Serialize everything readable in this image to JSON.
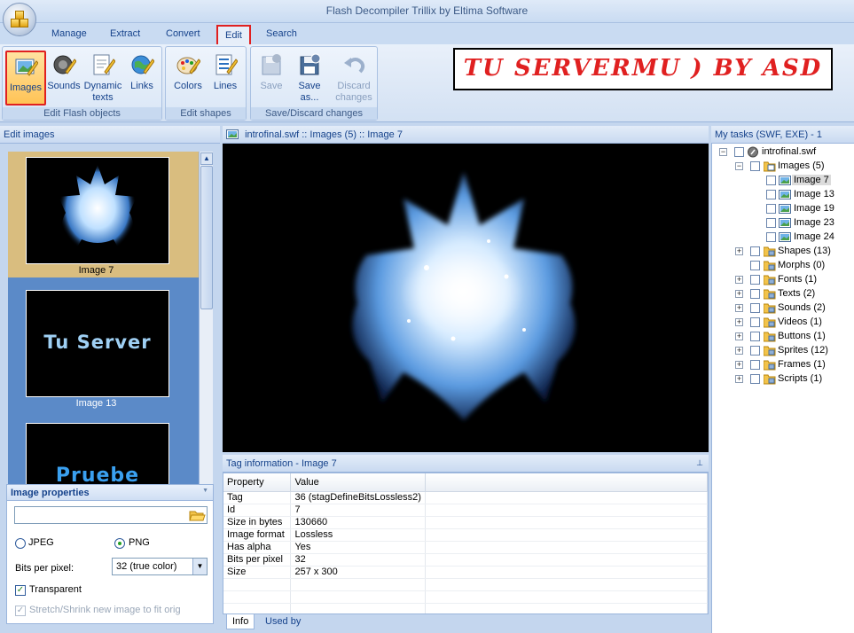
{
  "window": {
    "title": "Flash Decompiler Trillix by Eltima Software"
  },
  "menu": {
    "tabs": [
      "Manage",
      "Extract",
      "Convert",
      "Edit",
      "Search"
    ],
    "active": "Edit"
  },
  "ribbon": {
    "groups": {
      "edit_flash_objects": "Edit Flash objects",
      "edit_shapes": "Edit shapes",
      "save_discard": "Save/Discard changes"
    },
    "buttons": {
      "images": "Images",
      "sounds": "Sounds",
      "dynamic_texts_1": "Dynamic",
      "dynamic_texts_2": "texts",
      "links": "Links",
      "colors": "Colors",
      "lines": "Lines",
      "save": "Save",
      "save_as_1": "Save",
      "save_as_2": "as...",
      "discard_1": "Discard",
      "discard_2": "changes"
    }
  },
  "banner": {
    "text": "TU SERVERMU ) BY ASD"
  },
  "left_panel": {
    "title": "Edit images",
    "thumbnails": [
      {
        "caption": "Image 7",
        "selected": true
      },
      {
        "caption": "Image 13",
        "art_text": "Tu Server",
        "selected": false
      },
      {
        "caption": "",
        "art_text": "Pruebe",
        "selected": false
      }
    ],
    "properties": {
      "title": "Image properties",
      "file_value": "",
      "format_jpeg": "JPEG",
      "format_png": "PNG",
      "format_selected": "PNG",
      "bits_label": "Bits per pixel:",
      "bits_value": "32 (true color)",
      "transparent_label": "Transparent",
      "transparent_checked": true,
      "stretch_label": "Stretch/Shrink new image to fit orig",
      "stretch_checked": true
    }
  },
  "preview": {
    "title": "introfinal.swf :: Images (5) :: Image 7"
  },
  "tag_info": {
    "title": "Tag information - Image 7",
    "columns": [
      "Property",
      "Value"
    ],
    "rows": [
      [
        "Tag",
        "36 (stagDefineBitsLossless2)"
      ],
      [
        "Id",
        "7"
      ],
      [
        "Size in bytes",
        "130660"
      ],
      [
        "Image format",
        "Lossless"
      ],
      [
        "Has alpha",
        "Yes"
      ],
      [
        "Bits per pixel",
        "32"
      ],
      [
        "Size",
        "257 x 300"
      ]
    ],
    "tabs": [
      "Info",
      "Used by"
    ],
    "pin_icon": "pin-icon"
  },
  "tasks": {
    "title": "My tasks (SWF, EXE) - 1",
    "tree": {
      "root": "introfinal.swf",
      "images": "Images (5)",
      "image_items": [
        "Image 7",
        "Image 13",
        "Image 19",
        "Image 23",
        "Image 24"
      ],
      "selected": "Image 7",
      "others": [
        "Shapes (13)",
        "Morphs (0)",
        "Fonts (1)",
        "Texts (2)",
        "Sounds (2)",
        "Videos (1)",
        "Buttons (1)",
        "Sprites (12)",
        "Frames (1)",
        "Scripts (1)"
      ]
    }
  },
  "colors": {
    "accent_red": "#e02020",
    "ribbon_text": "#15428b",
    "thumb_bg": "#5b8ac8",
    "selected_thumb": "#d9bd7f"
  }
}
